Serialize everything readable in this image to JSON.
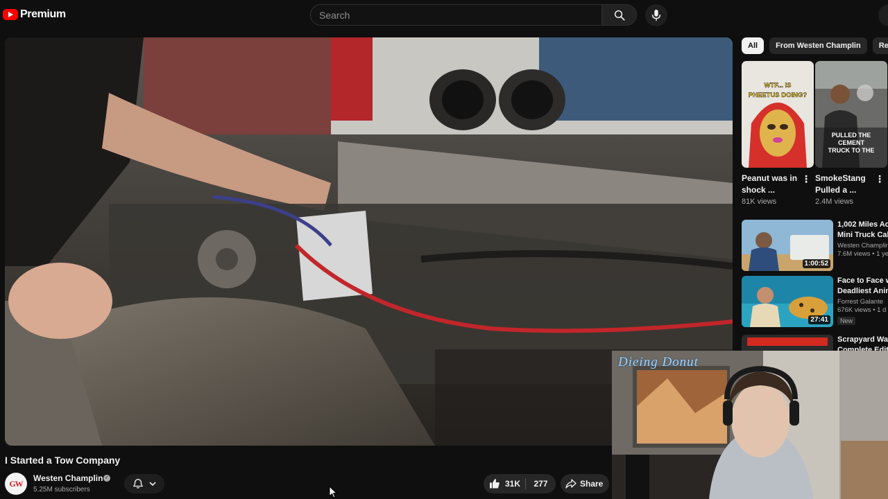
{
  "header": {
    "logo_text": "Premium",
    "search_placeholder": "Search",
    "icons": [
      "youtube-logo-icon",
      "search-icon",
      "microphone-icon"
    ]
  },
  "video": {
    "title": "I Started a Tow Company",
    "channel": "Westen Champlin",
    "channel_initials": "GW",
    "subscribers": "5.25M subscribers",
    "likes": "31K",
    "dislike_count": "277",
    "share_label": "Share"
  },
  "sidebar": {
    "chips": [
      "All",
      "From Westen Champlin",
      "Relat"
    ],
    "shorts": [
      {
        "title": "Peanut was in shock ...",
        "views": "81K views",
        "thumb_text": "WTF... IS PHEETUS DOING?"
      },
      {
        "title": "SmokeStang Pulled a ...",
        "views": "2.4M views",
        "thumb_text": "PULLED THE CEMENT TRUCK TO THE"
      }
    ],
    "recommended": [
      {
        "title_line1": "1,002 Miles Ac",
        "title_line2": "Mini Truck Cab",
        "channel": "Westen Champlin",
        "meta": "7.6M views • 1 ye",
        "duration": "1:00:52"
      },
      {
        "title_line1": "Face to Face w",
        "title_line2": "Deadliest Anim",
        "channel": "Forrest Galante",
        "meta": "676K views • 1 d",
        "duration": "27:41",
        "badge": "New"
      },
      {
        "title_line1": "Scrapyard War",
        "title_line2": "Complete Editi",
        "channel": "",
        "meta": "",
        "duration": ""
      }
    ]
  },
  "webcam": {
    "label": "Dieing  Donut"
  },
  "colors": {
    "background": "#0f0f0f",
    "accent_red": "#ff0000",
    "chip_active_bg": "#f1f1f1",
    "button_bg": "#272727"
  }
}
